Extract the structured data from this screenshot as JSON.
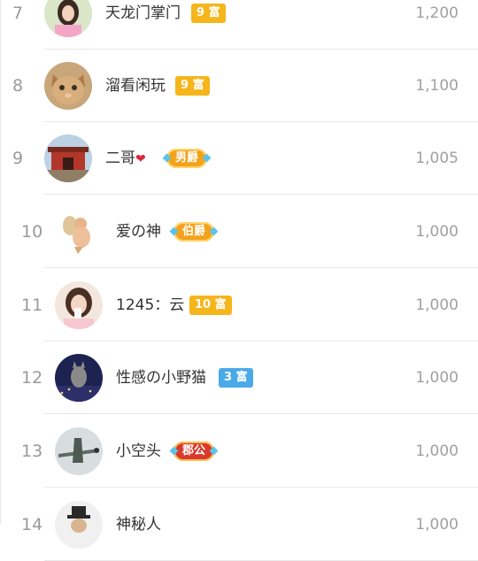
{
  "rows": [
    {
      "rank": "7",
      "name": "天龙门掌门",
      "badge": "9 富",
      "badge_type": "gold",
      "score": "1,200",
      "avatar": "woman-photo-avatar"
    },
    {
      "rank": "8",
      "name": "溜看闲玩",
      "badge": "9 富",
      "badge_type": "gold",
      "score": "1,100",
      "avatar": "cat-avatar"
    },
    {
      "rank": "9",
      "name": "二哥",
      "badge": "男爵",
      "badge_type": "noble",
      "score": "1,005",
      "avatar": "gate-building-avatar"
    },
    {
      "rank": "10",
      "name": "爱の神",
      "badge": "伯爵",
      "badge_type": "noble",
      "score": "1,000",
      "avatar": "cupid-avatar"
    },
    {
      "rank": "11",
      "name": "1245：云",
      "badge": "10 富",
      "badge_type": "gold",
      "score": "1,000",
      "avatar": "girl-photo-avatar"
    },
    {
      "rank": "12",
      "name": "性感の小野猫",
      "badge": "3 富",
      "badge_type": "blue",
      "score": "1,000",
      "avatar": "city-night-avatar"
    },
    {
      "rank": "13",
      "name": "小空头",
      "badge": "郡公",
      "badge_type": "noble-red",
      "score": "1,000",
      "avatar": "airplane-avatar"
    },
    {
      "rank": "14",
      "name": "神秘人",
      "badge": "",
      "badge_type": "",
      "score": "1,000",
      "avatar": "hat-man-avatar"
    }
  ],
  "colors": {
    "gold_badge": "#f5b51b",
    "blue_badge": "#4aa9e8",
    "noble_badge": "#f3a21c",
    "red_noble_badge": "#d93a2c"
  }
}
